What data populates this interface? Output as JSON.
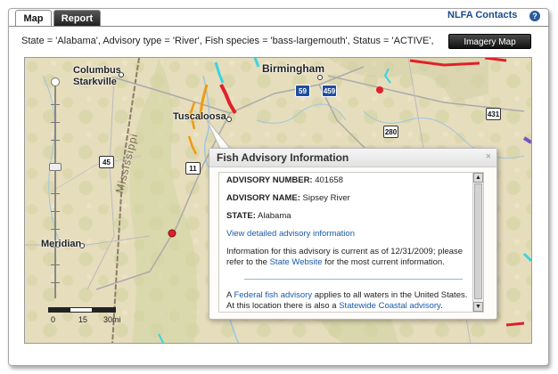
{
  "tabs": [
    {
      "label": "Map",
      "active": true
    },
    {
      "label": "Report",
      "active": false
    }
  ],
  "header": {
    "contacts_label": "NLFA Contacts",
    "help_label": "?"
  },
  "query_text": "State = 'Alabama', Advisory type = 'River', Fish species = 'bass-largemouth', Status = 'ACTIVE',",
  "imagery_button_label": "Imagery Map",
  "map": {
    "cities": [
      {
        "name": "Columbus"
      },
      {
        "name": "Starkville"
      },
      {
        "name": "Birmingham"
      },
      {
        "name": "Tuscaloosa"
      },
      {
        "name": "Meridian"
      }
    ],
    "state_label": "Mississippi",
    "shields": [
      "59",
      "459",
      "431",
      "280",
      "45",
      "11"
    ],
    "scale": {
      "labels": [
        "0",
        "15",
        "30mi"
      ]
    }
  },
  "popup": {
    "title": "Fish Advisory Information",
    "close_label": "×",
    "advisory_number_label": "ADVISORY NUMBER:",
    "advisory_number": "401658",
    "advisory_name_label": "ADVISORY NAME:",
    "advisory_name": "Sipsey River",
    "state_label": "STATE:",
    "state": "Alabama",
    "detail_link": "View detailed advisory information",
    "current_text_1": "Information for this advisory is current as of 12/31/2009; please refer to the",
    "state_website_link": "State Website",
    "current_text_2": "for the most current information.",
    "federal_prefix": "A",
    "federal_link": "Federal fish advisory",
    "federal_text": "applies to all waters in the United States. At this location there is also a",
    "statewide_link": "Statewide Coastal advisory",
    "federal_end": "."
  },
  "colors": {
    "accent_blue": "#1a4a8a",
    "link_blue": "#1a5aa8",
    "advisory_red": "#e0202a",
    "advisory_orange": "#f09a10",
    "advisory_cyan": "#3ad4e0",
    "map_base": "#e8dfc0"
  }
}
